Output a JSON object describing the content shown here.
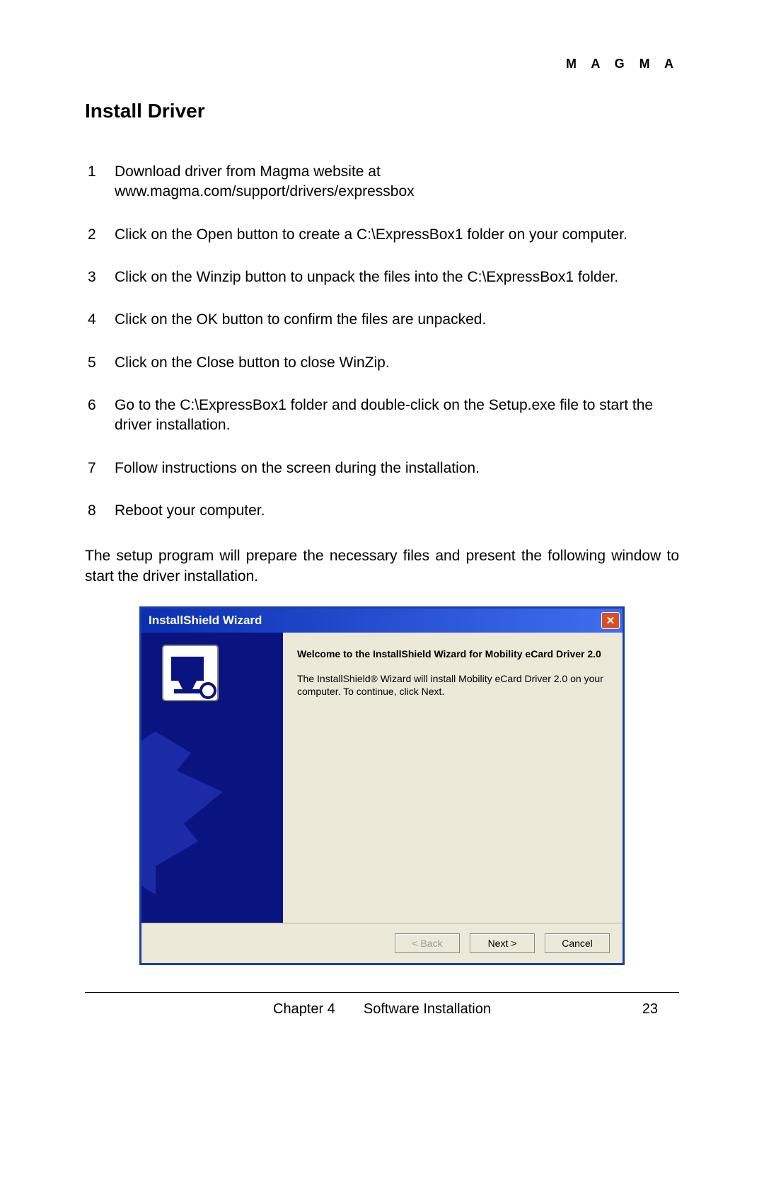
{
  "header": {
    "brand": "M A G M A"
  },
  "title": "Install Driver",
  "steps": [
    {
      "n": "1",
      "text": "Download driver from Magma website at www.magma.com/support/drivers/expressbox"
    },
    {
      "n": "2",
      "text": "Click on the Open button to create a C:\\ExpressBox1 folder on your computer."
    },
    {
      "n": "3",
      "text": "Click on the Winzip button to unpack the files into the C:\\ExpressBox1 folder."
    },
    {
      "n": "4",
      "text": "Click on the OK button to confirm the files are unpacked."
    },
    {
      "n": "5",
      "text": "Click on the Close button to close WinZip."
    },
    {
      "n": "6",
      "text": "Go to the C:\\ExpressBox1 folder and double-click on the Setup.exe file to start the driver installation."
    },
    {
      "n": "7",
      "text": "Follow instructions on the screen during the installation."
    },
    {
      "n": "8",
      "text": "Reboot your computer."
    }
  ],
  "post_text": "The setup program will prepare the necessary files and present the following window to start the driver installation.",
  "dialog": {
    "titlebar": "InstallShield Wizard",
    "close_label": "✕",
    "welcome": "Welcome to the InstallShield Wizard for Mobility eCard Driver 2.0",
    "description": "The InstallShield® Wizard will install Mobility eCard Driver 2.0 on your computer.  To continue, click Next.",
    "buttons": {
      "back": "< Back",
      "next": "Next >",
      "cancel": "Cancel"
    }
  },
  "footer": {
    "chapter": "Chapter 4",
    "section": "Software Installation",
    "page": "23"
  }
}
